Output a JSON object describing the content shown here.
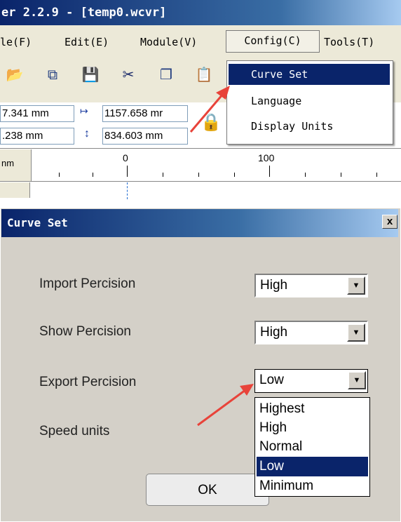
{
  "app": {
    "title": "er 2.2.9 - [temp0.wcvr]",
    "menu": {
      "file": "le(F)",
      "edit": "Edit(E)",
      "module": "Module(V)",
      "config": "Config(C)",
      "tools": "Tools(T)"
    },
    "toolbar_icons": [
      "open-folder-icon",
      "export-icon",
      "save-icon",
      "cut-icon",
      "copy-icon",
      "paste-icon"
    ],
    "fields": {
      "x_pos": "7.341 mm",
      "width": "1157.658 mr",
      "y_pos": ".238 mm",
      "height": "834.603 mm"
    },
    "ruler": {
      "unit": "nm",
      "labels": [
        "0",
        "100"
      ]
    },
    "config_menu": {
      "items": [
        {
          "label": "Curve Set",
          "selected": true
        },
        {
          "label": "Language",
          "selected": false
        },
        {
          "label": "Display Units",
          "selected": false
        }
      ]
    }
  },
  "dialog": {
    "title": "Curve Set",
    "close_label": "x",
    "rows": {
      "import_label": "Import Percision",
      "import_value": "High",
      "show_label": "Show Percision",
      "show_value": "High",
      "export_label": "Export Percision",
      "export_value": "Low",
      "speed_label": "Speed units"
    },
    "export_options": [
      {
        "label": "Highest",
        "selected": false
      },
      {
        "label": "High",
        "selected": false
      },
      {
        "label": "Normal",
        "selected": false
      },
      {
        "label": "Low",
        "selected": true
      },
      {
        "label": "Minimum",
        "selected": false
      }
    ],
    "ok_label": "OK"
  },
  "colors": {
    "titlebar": "#0a246a",
    "selection": "#0a246a",
    "arrow": "#e8433a"
  }
}
